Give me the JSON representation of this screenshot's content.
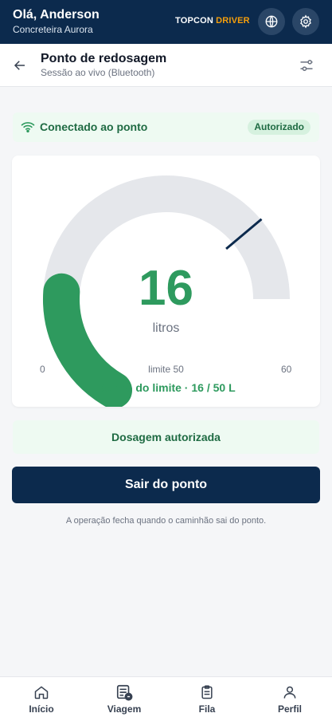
{
  "header": {
    "greeting": "Olá, Anderson",
    "company": "Concreteira Aurora",
    "brand_primary": "TOPCON",
    "brand_secondary": "DRIVER",
    "icons": [
      "globe-icon",
      "gear-icon"
    ],
    "colors": {
      "bar": "#0c2a4d",
      "brand_accent": "#f59e0b"
    }
  },
  "subheader": {
    "title": "Ponto de redosagem",
    "subtitle": "Sessão ao vivo (Bluetooth)",
    "icons": [
      "arrow-left-icon",
      "sliders-icon"
    ]
  },
  "connection": {
    "label": "Conectado ao ponto",
    "badge": "Autorizado",
    "icon": "wifi-icon"
  },
  "gauge": {
    "value": 16,
    "unit": "litros",
    "min": 0,
    "max": 60,
    "limit": 50,
    "min_label": "0",
    "max_label": "60",
    "limit_label": "limite 50",
    "status": "Dentro do limite · 16 / 50 L",
    "colors": {
      "fill": "#2e9a5e",
      "track": "#e5e7eb",
      "limit_marker": "#0c2a4d"
    }
  },
  "dosage_status": "Dosagem autorizada",
  "exit_button": "Sair do ponto",
  "note": "A operação fecha quando o caminhão sai do ponto.",
  "nav": [
    {
      "label": "Início",
      "icon": "home-icon"
    },
    {
      "label": "Viagem",
      "icon": "trip-icon"
    },
    {
      "label": "Fila",
      "icon": "clipboard-icon"
    },
    {
      "label": "Perfil",
      "icon": "user-icon"
    }
  ]
}
